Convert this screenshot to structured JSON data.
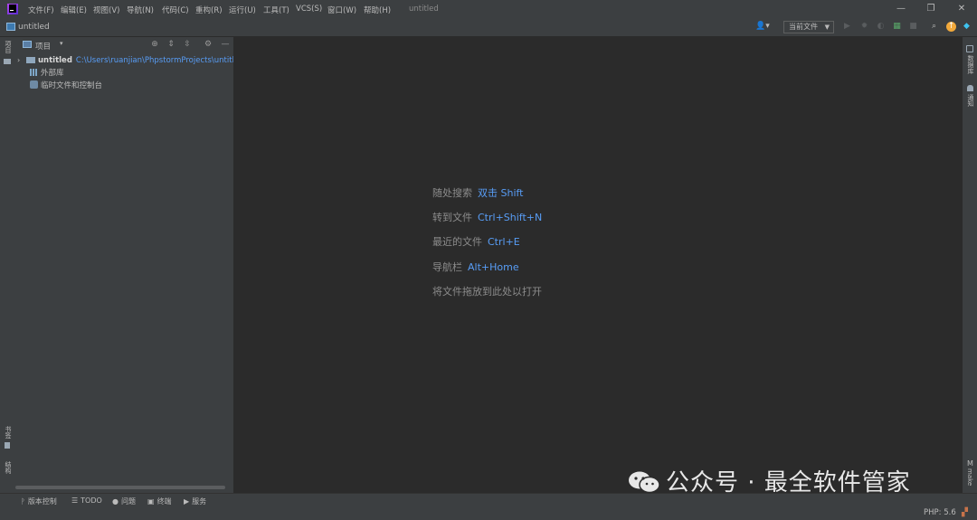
{
  "menu": [
    "文件(F)",
    "编辑(E)",
    "视图(V)",
    "导航(N)",
    "代码(C)",
    "重构(R)",
    "运行(U)",
    "工具(T)",
    "VCS(S)",
    "窗口(W)",
    "帮助(H)"
  ],
  "window_title": "untitled",
  "window_controls": {
    "minimize": "—",
    "restore": "❐",
    "close": "✕"
  },
  "navbar": {
    "project": "untitled",
    "user_icon": "👤▾",
    "current_file": "当前文件",
    "dropdown_arrow": "▼"
  },
  "left_strip": {
    "project_tab": "项目",
    "bookmarks_tab": "书签",
    "structure_tab": "结构"
  },
  "right_strip": {
    "database_tab": "数据库",
    "notifications_tab": "通知",
    "make_tab": "make"
  },
  "panel": {
    "title": "项目",
    "dropdown": "▾"
  },
  "tree": {
    "root": {
      "name": "untitled",
      "path": "C:\\Users\\ruanjian\\PhpstormProjects\\untitled"
    },
    "external_libraries": "外部库",
    "scratches": "临时文件和控制台"
  },
  "editor_hints": [
    {
      "text": "随处搜索",
      "key": "双击 Shift"
    },
    {
      "text": "转到文件",
      "key": "Ctrl+Shift+N"
    },
    {
      "text": "最近的文件",
      "key": "Ctrl+E"
    },
    {
      "text": "导航栏",
      "key": "Alt+Home"
    },
    {
      "text": "将文件拖放到此处以打开",
      "key": ""
    }
  ],
  "bottom_tabs": [
    {
      "icon": "ᚹ",
      "label": "版本控制"
    },
    {
      "icon": "☰",
      "label": "TODO"
    },
    {
      "icon": "●",
      "label": "问题"
    },
    {
      "icon": "▣",
      "label": "终端"
    },
    {
      "icon": "▶",
      "label": "服务"
    }
  ],
  "status": {
    "php_version": "PHP: 5.6"
  },
  "watermark": "公众号 · 最全软件管家"
}
